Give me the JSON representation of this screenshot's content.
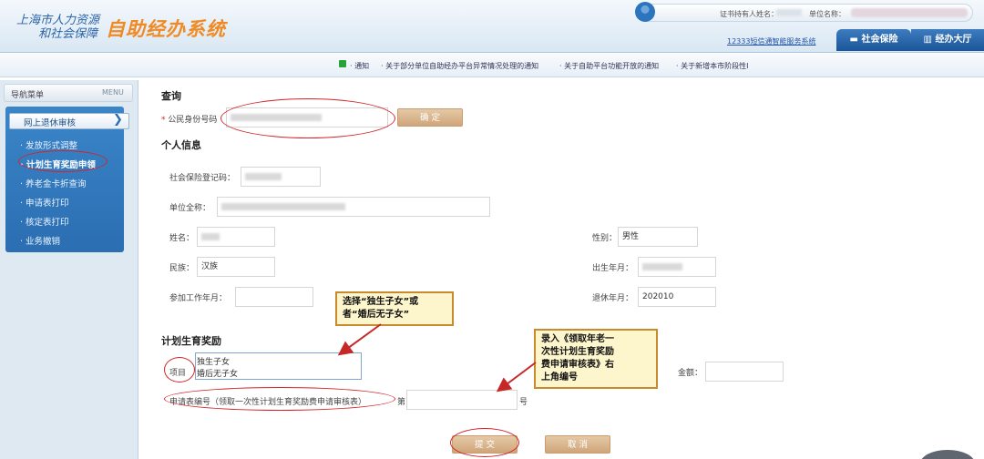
{
  "header": {
    "logo_line1": "上海市人力资源",
    "logo_line2": "和社会保障",
    "system_name": "自助经办系统",
    "cert_holder_label": "证书持有人姓名：",
    "unit_name_label": "单位名称：",
    "service_link": "12333短信通智能服务系统",
    "tabs": [
      "社会保险",
      "经办大厅"
    ]
  },
  "notice": {
    "label": "· 通知",
    "items": [
      "· 关于部分单位自助经办平台异常情况处理的通知",
      "· 关于自助平台功能开放的通知",
      "· 关于新增本市阶段性I"
    ]
  },
  "sidebar": {
    "nav_title": "导航菜单",
    "menu_label": "MENU",
    "group_label": "网上退休审核",
    "items": [
      {
        "label": "· 发放形式调整"
      },
      {
        "label": "· 计划生育奖励申领"
      },
      {
        "label": "· 养老金卡折查询"
      },
      {
        "label": "· 申请表打印"
      },
      {
        "label": "· 核定表打印"
      },
      {
        "label": "· 业务撤销"
      }
    ]
  },
  "query": {
    "title": "查询",
    "required_mark": "*",
    "id_label": "公民身份号码",
    "confirm_button": "确 定"
  },
  "personal": {
    "title": "个人信息",
    "social_security_label": "社会保险登记码：",
    "unit_fullname_label": "单位全称：",
    "name_label": "姓名：",
    "gender_label": "性别：",
    "gender_value": "男性",
    "ethnicity_label": "民族：",
    "ethnicity_value": "汉族",
    "birth_label": "出生年月：",
    "work_start_label": "参加工作年月：",
    "retire_label": "退休年月：",
    "retire_value": "202010"
  },
  "reward": {
    "title": "计划生育奖励",
    "item_label": "项目",
    "options": [
      "独生子女",
      "婚后无子女"
    ],
    "amount_label": "金额：",
    "form_no_label": "申请表编号（领取一次性计划生育奖励费申请审核表）",
    "form_no_prefix": "第",
    "form_no_suffix": "号",
    "submit_button": "提 交",
    "cancel_button": "取 消"
  },
  "annotations": {
    "callout1": [
      "选择“独生子女”或",
      "者“婚后无子女”"
    ],
    "callout2": [
      "录入《领取年老一",
      "次性计划生育奖励",
      "费申请审核表》右",
      "上角编号"
    ]
  },
  "colors": {
    "brand_blue": "#2a64a8",
    "accent_orange": "#f08a24",
    "sidebar_blue": "#2b6eb1",
    "button_tan": "#cfa57a",
    "callout_red": "#d2252a"
  }
}
